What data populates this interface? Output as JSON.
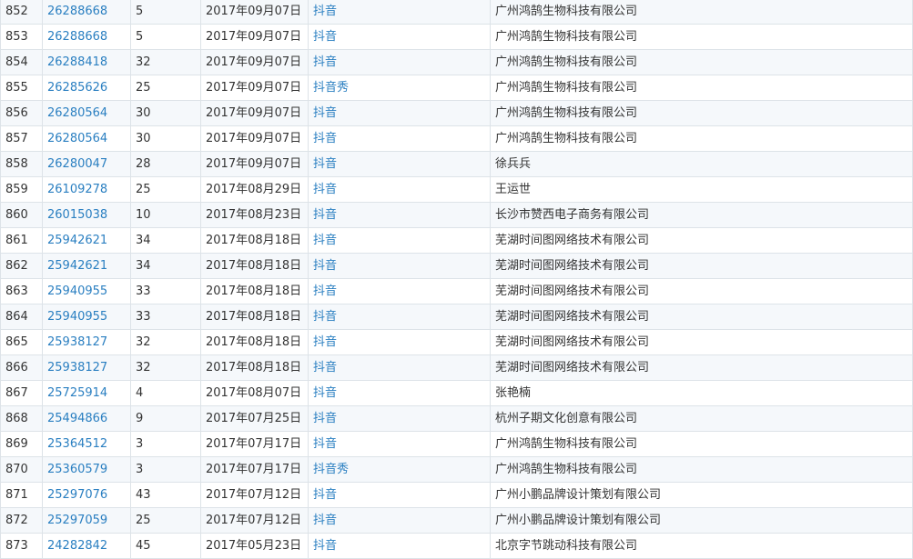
{
  "table": {
    "rows": [
      {
        "index": "852",
        "reg_no": "26288668",
        "class": "5",
        "date": "2017年09月07日",
        "name": "抖音",
        "applicant": "广州鸿鹄生物科技有限公司"
      },
      {
        "index": "853",
        "reg_no": "26288668",
        "class": "5",
        "date": "2017年09月07日",
        "name": "抖音",
        "applicant": "广州鸿鹄生物科技有限公司"
      },
      {
        "index": "854",
        "reg_no": "26288418",
        "class": "32",
        "date": "2017年09月07日",
        "name": "抖音",
        "applicant": "广州鸿鹄生物科技有限公司"
      },
      {
        "index": "855",
        "reg_no": "26285626",
        "class": "25",
        "date": "2017年09月07日",
        "name": "抖音秀",
        "applicant": "广州鸿鹄生物科技有限公司"
      },
      {
        "index": "856",
        "reg_no": "26280564",
        "class": "30",
        "date": "2017年09月07日",
        "name": "抖音",
        "applicant": "广州鸿鹄生物科技有限公司"
      },
      {
        "index": "857",
        "reg_no": "26280564",
        "class": "30",
        "date": "2017年09月07日",
        "name": "抖音",
        "applicant": "广州鸿鹄生物科技有限公司"
      },
      {
        "index": "858",
        "reg_no": "26280047",
        "class": "28",
        "date": "2017年09月07日",
        "name": "抖音",
        "applicant": "徐兵兵"
      },
      {
        "index": "859",
        "reg_no": "26109278",
        "class": "25",
        "date": "2017年08月29日",
        "name": "抖音",
        "applicant": "王运世"
      },
      {
        "index": "860",
        "reg_no": "26015038",
        "class": "10",
        "date": "2017年08月23日",
        "name": "抖音",
        "applicant": "长沙市赞西电子商务有限公司"
      },
      {
        "index": "861",
        "reg_no": "25942621",
        "class": "34",
        "date": "2017年08月18日",
        "name": "抖音",
        "applicant": "芜湖时间图网络技术有限公司"
      },
      {
        "index": "862",
        "reg_no": "25942621",
        "class": "34",
        "date": "2017年08月18日",
        "name": "抖音",
        "applicant": "芜湖时间图网络技术有限公司"
      },
      {
        "index": "863",
        "reg_no": "25940955",
        "class": "33",
        "date": "2017年08月18日",
        "name": "抖音",
        "applicant": "芜湖时间图网络技术有限公司"
      },
      {
        "index": "864",
        "reg_no": "25940955",
        "class": "33",
        "date": "2017年08月18日",
        "name": "抖音",
        "applicant": "芜湖时间图网络技术有限公司"
      },
      {
        "index": "865",
        "reg_no": "25938127",
        "class": "32",
        "date": "2017年08月18日",
        "name": "抖音",
        "applicant": "芜湖时间图网络技术有限公司"
      },
      {
        "index": "866",
        "reg_no": "25938127",
        "class": "32",
        "date": "2017年08月18日",
        "name": "抖音",
        "applicant": "芜湖时间图网络技术有限公司"
      },
      {
        "index": "867",
        "reg_no": "25725914",
        "class": "4",
        "date": "2017年08月07日",
        "name": "抖音",
        "applicant": "张艳楠"
      },
      {
        "index": "868",
        "reg_no": "25494866",
        "class": "9",
        "date": "2017年07月25日",
        "name": "抖音",
        "applicant": "杭州子期文化创意有限公司"
      },
      {
        "index": "869",
        "reg_no": "25364512",
        "class": "3",
        "date": "2017年07月17日",
        "name": "抖音",
        "applicant": "广州鸿鹄生物科技有限公司"
      },
      {
        "index": "870",
        "reg_no": "25360579",
        "class": "3",
        "date": "2017年07月17日",
        "name": "抖音秀",
        "applicant": "广州鸿鹄生物科技有限公司"
      },
      {
        "index": "871",
        "reg_no": "25297076",
        "class": "43",
        "date": "2017年07月12日",
        "name": "抖音",
        "applicant": "广州小鹏品牌设计策划有限公司"
      },
      {
        "index": "872",
        "reg_no": "25297059",
        "class": "25",
        "date": "2017年07月12日",
        "name": "抖音",
        "applicant": "广州小鹏品牌设计策划有限公司"
      },
      {
        "index": "873",
        "reg_no": "24282842",
        "class": "45",
        "date": "2017年05月23日",
        "name": "抖音",
        "applicant": "北京字节跳动科技有限公司"
      }
    ]
  },
  "colors": {
    "link": "#2a7fc1",
    "text": "#333333",
    "border": "#dde3e8",
    "row_alt": "#f5f8fb"
  }
}
